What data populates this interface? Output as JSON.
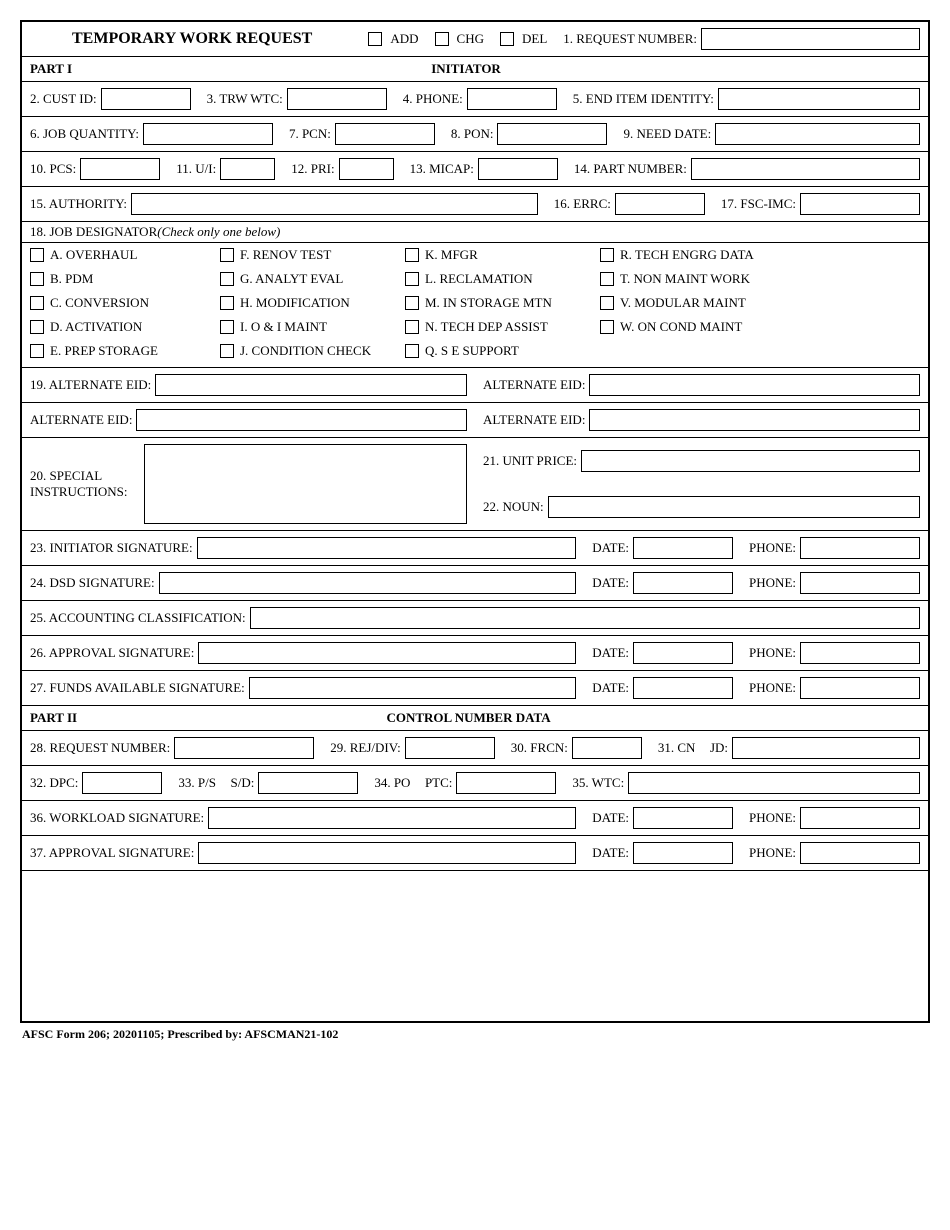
{
  "header": {
    "title": "TEMPORARY WORK REQUEST",
    "add": "ADD",
    "chg": "CHG",
    "del": "DEL",
    "req_num": "1.  REQUEST NUMBER:"
  },
  "part1": {
    "label": "PART I",
    "sub": "INITIATOR"
  },
  "f2": "2. CUST ID:",
  "f3": "3. TRW WTC:",
  "f4": "4. PHONE:",
  "f5": "5. END ITEM IDENTITY:",
  "f6": "6. JOB QUANTITY:",
  "f7": "7. PCN:",
  "f8": "8. PON:",
  "f9": "9. NEED DATE:",
  "f10": "10. PCS:",
  "f11": "11. U/I:",
  "f12": "12. PRI:",
  "f13": "13. MICAP:",
  "f14": "14. PART NUMBER:",
  "f15": "15. AUTHORITY:",
  "f16": "16. ERRC:",
  "f17": "17. FSC-IMC:",
  "f18": "18.  JOB DESIGNATOR",
  "f18note": " (Check only one below)",
  "jd": {
    "a": "A.  OVERHAUL",
    "b": "B.  PDM",
    "c": "C. CONVERSION",
    "d": "D. ACTIVATION",
    "e": "E. PREP STORAGE",
    "f": "F. RENOV TEST",
    "g": "G. ANALYT EVAL",
    "h": "H. MODIFICATION",
    "i": "I. O & I MAINT",
    "j": "J. CONDITION CHECK",
    "k": "K. MFGR",
    "l": "L. RECLAMATION",
    "m": "M. IN STORAGE MTN",
    "n": "N. TECH DEP ASSIST",
    "q": "Q. S E SUPPORT",
    "r": "R. TECH ENGRG DATA",
    "t": "T. NON MAINT WORK",
    "v": "V. MODULAR MAINT",
    "w": "W. ON COND MAINT"
  },
  "f19": "19. ALTERNATE EID:",
  "alt_eid": "ALTERNATE EID:",
  "f20": "20. SPECIAL INSTRUCTIONS:",
  "f21": "21. UNIT PRICE:",
  "f22": "22. NOUN:",
  "f23": "23. INITIATOR SIGNATURE:",
  "f24": "24. DSD SIGNATURE:",
  "f25": "25. ACCOUNTING CLASSIFICATION:",
  "f26": "26. APPROVAL SIGNATURE:",
  "f27": "27. FUNDS AVAILABLE SIGNATURE:",
  "date": "DATE:",
  "phone": "PHONE:",
  "part2": {
    "label": "PART II",
    "sub": "CONTROL NUMBER DATA"
  },
  "f28": "28. REQUEST NUMBER:",
  "f29": "29. REJ/DIV:",
  "f30": "30. FRCN:",
  "f31": "31. CN",
  "f31b": "JD:",
  "f32": "32. DPC:",
  "f33": "33. P/S",
  "f33b": "S/D:",
  "f34": "34. PO",
  "f34b": "PTC:",
  "f35": "35. WTC:",
  "f36": "36. WORKLOAD SIGNATURE:",
  "f37": "37. APPROVAL  SIGNATURE:",
  "footer": "AFSC Form 206; 20201105; Prescribed by: AFSCMAN21-102"
}
